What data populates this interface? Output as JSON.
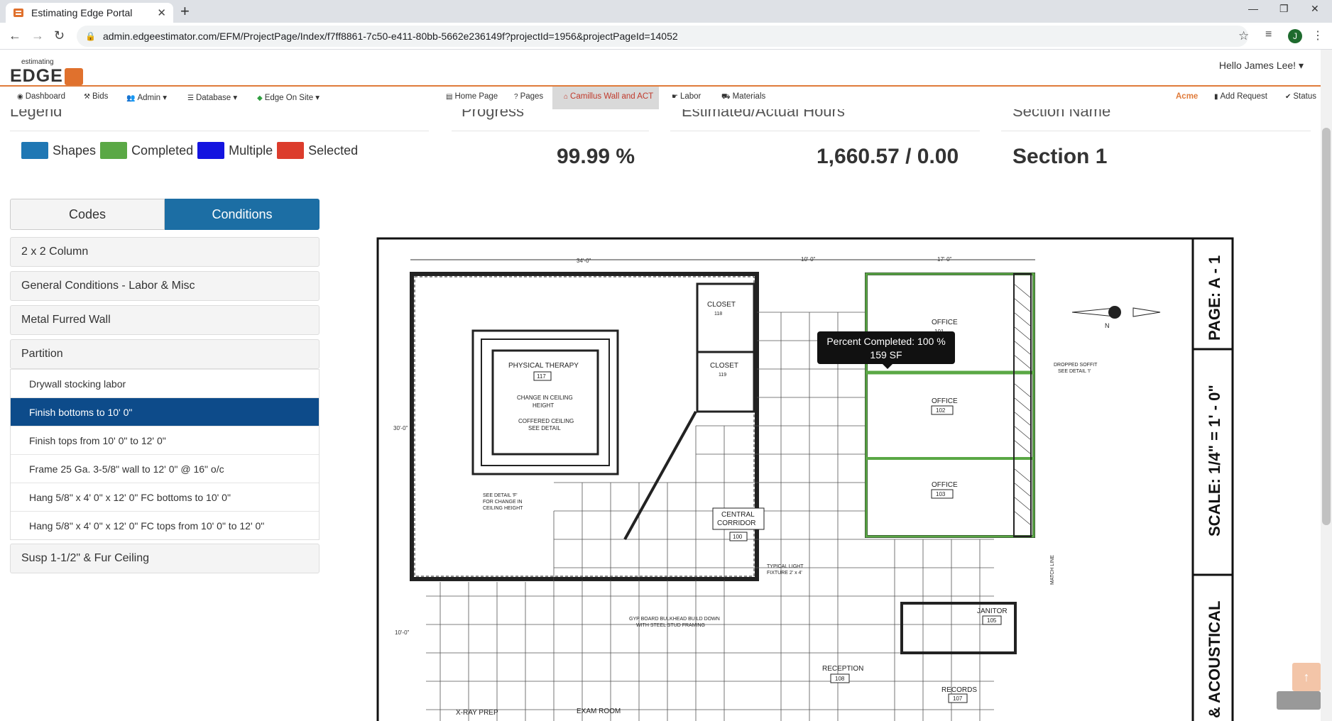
{
  "browser": {
    "tab_title": "Estimating Edge Portal",
    "url": "admin.edgeestimator.com/EFM/ProjectPage/Index/f7ff8861-7c50-e411-80bb-5662e236149f?projectId=1956&projectPageId=14052",
    "profile_initial": "J"
  },
  "app": {
    "logo_small": "estimating",
    "logo_big": "EDGE",
    "user_greeting": "Hello James Lee! ▾",
    "nav_left": [
      "Dashboard",
      "Bids",
      "Admin ▾",
      "Database ▾",
      "Edge On Site ▾"
    ],
    "nav_center": [
      "Home Page",
      "Pages",
      "Camillus Wall and ACT",
      "Labor",
      "Materials"
    ],
    "nav_right": [
      "Acme",
      "Add Request",
      "Status"
    ],
    "brand_color": "#e07b3a"
  },
  "summary": {
    "legend_title": "Legend",
    "progress_title": "Progress",
    "hours_title": "Estimated/Actual Hours",
    "section_title": "Section Name",
    "progress_value": "99.99 %",
    "hours_value": "1,660.57 / 0.00",
    "section_value": "Section 1",
    "legend": [
      {
        "label": "Shapes",
        "color": "#1f77b4"
      },
      {
        "label": "Completed",
        "color": "#5aa845"
      },
      {
        "label": "Multiple",
        "color": "#1414e0"
      },
      {
        "label": "Selected",
        "color": "#dc3c2c"
      }
    ]
  },
  "sidebar": {
    "tab_codes": "Codes",
    "tab_conditions": "Conditions",
    "conditions": [
      "2 x 2 Column",
      "General Conditions - Labor & Misc",
      "Metal Furred Wall",
      "Partition"
    ],
    "partition_items": [
      "Drywall stocking labor",
      "Finish bottoms to 10' 0\"",
      "Finish tops from 10' 0\" to 12' 0\"",
      "Frame 25 Ga. 3-5/8\" wall to 12' 0\" @ 16\" o/c",
      "Hang 5/8\" x 4' 0\" x 12' 0\" FC bottoms to 10' 0\"",
      "Hang 5/8\" x 4' 0\" x 12' 0\" FC tops from 10' 0\" to 12' 0\""
    ],
    "last_condition": "Susp 1-1/2\" & Fur Ceiling"
  },
  "tooltip": {
    "line1": "Percent Completed: 100 %",
    "line2": "159 SF"
  },
  "drawing": {
    "page_label": "PAGE: A - 1",
    "scale_label": "SCALE: 1/4\" = 1' - 0\"",
    "acoustical_label": "& ACOUSTICAL",
    "north": "N",
    "dim_34": "34'-0\"",
    "dim_10": "10'-0\"",
    "dim_17": "17'-0\"",
    "dim_30": "30'-0\"",
    "dim_10b": "10'-0\"",
    "physical_therapy": "PHYSICAL THERAPY",
    "pt_num": "117",
    "pt_note1": "CHANGE IN CEILING",
    "pt_note1b": "HEIGHT",
    "pt_note2": "COFFERED CEILING",
    "pt_note2b": "SEE DETAIL",
    "closet1": "CLOSET",
    "closet1_num": "118",
    "closet2": "CLOSET",
    "closet2_num": "119",
    "office1": "OFFICE",
    "office1_num": "101",
    "office2": "OFFICE",
    "office2_num": "102",
    "office3": "OFFICE",
    "office3_num": "103",
    "dropped_soffit": "DROPPED SOFFIT",
    "dropped_soffit2": "SEE DETAIL 'I'",
    "see_detail_f": "SEE DETAIL 'F'",
    "see_detail_f2": "FOR CHANGE IN",
    "see_detail_f3": "CEILING HEIGHT",
    "central": "CENTRAL",
    "corridor": "CORRIDOR",
    "corridor_num": "100",
    "typical_light": "TYPICAL LIGHT",
    "typical_light2": "FIXTURE 2' x 4'",
    "gyp": "GYP BOARD BULKHEAD BUILD DOWN",
    "gyp2": "WITH STEEL STUD FRAMING",
    "janitor": "JANITOR",
    "janitor_num": "105",
    "reception": "RECEPTION",
    "reception_num": "108",
    "records": "RECORDS",
    "records_num": "107",
    "xray": "X-RAY PREP",
    "exam": "EXAM ROOM",
    "match_line": "MATCH LINE"
  }
}
